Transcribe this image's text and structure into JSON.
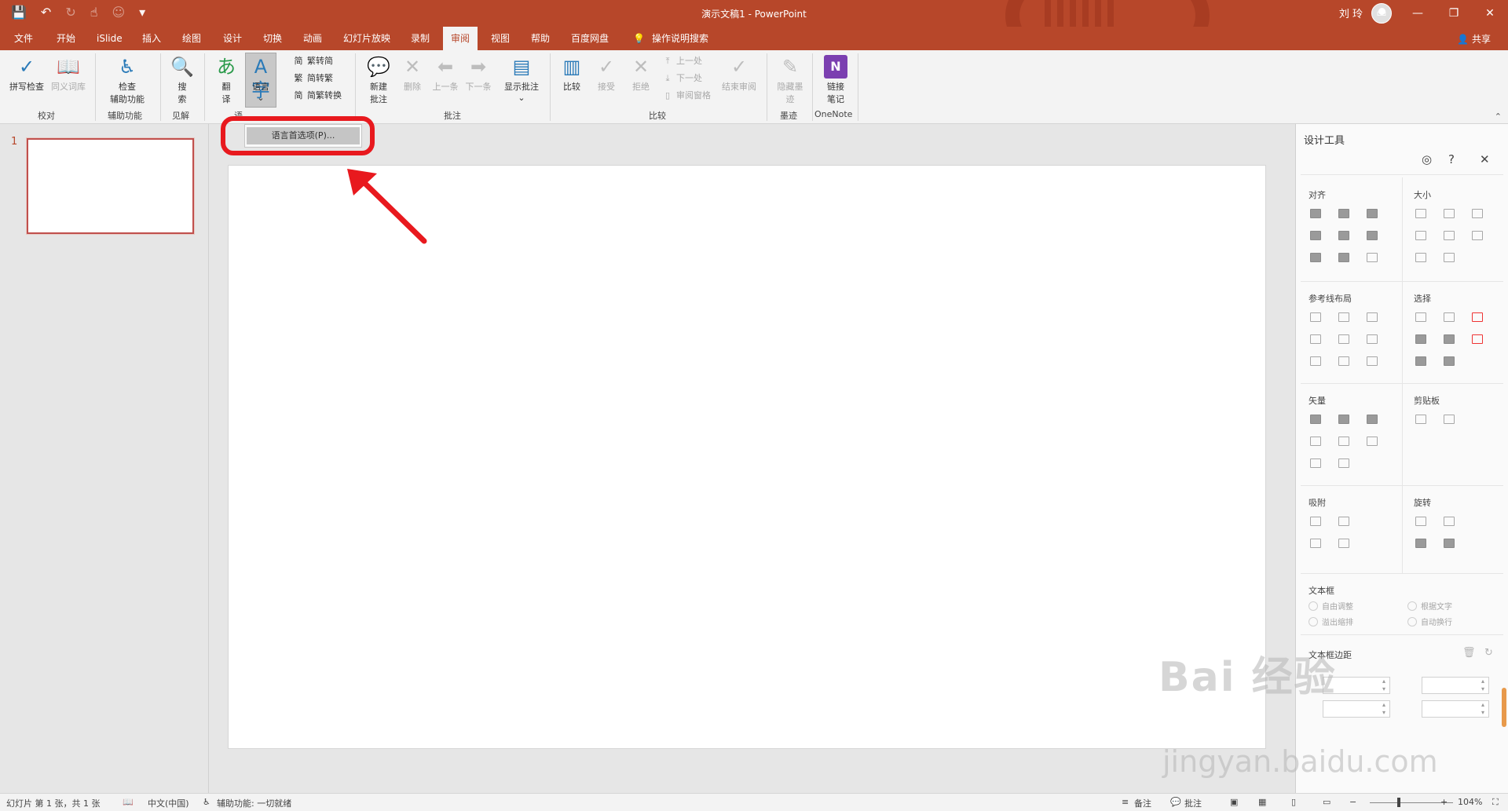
{
  "window": {
    "title": "演示文稿1  -  PowerPoint",
    "user": "刘 玲"
  },
  "tabs": [
    {
      "label": "文件"
    },
    {
      "label": "开始"
    },
    {
      "label": "iSlide"
    },
    {
      "label": "插入"
    },
    {
      "label": "绘图"
    },
    {
      "label": "设计"
    },
    {
      "label": "切换"
    },
    {
      "label": "动画"
    },
    {
      "label": "幻灯片放映"
    },
    {
      "label": "录制"
    },
    {
      "label": "审阅"
    },
    {
      "label": "视图"
    },
    {
      "label": "帮助"
    },
    {
      "label": "百度网盘"
    },
    {
      "label": "操作说明搜索"
    }
  ],
  "share_label": "共享",
  "ribbon": {
    "spell": "拼写检查",
    "thesaurus": "同义词库",
    "group_proof": "校对",
    "check_access": "检查",
    "check_access2": "辅助功能",
    "group_access": "辅助功能",
    "search": "搜",
    "search2": "索",
    "group_insight": "见解",
    "translate": "翻",
    "translate2": "译",
    "language": "语言",
    "group_lang": "语",
    "t2s": "繁转简",
    "s2t": "简转繁",
    "conv": "简繁转换",
    "new_comment": "新建",
    "new_comment2": "批注",
    "delete": "删除",
    "prev": "上一条",
    "next": "下一条",
    "show_comments": "显示批注",
    "group_comments": "批注",
    "compare": "比较",
    "accept": "接受",
    "reject": "拒绝",
    "prev_change": "上一处",
    "next_change": "下一处",
    "review_pane": "审阅窗格",
    "end_review": "结束审阅",
    "group_compare": "比较",
    "hide_ink": "隐藏墨",
    "hide_ink2": "迹",
    "group_ink": "墨迹",
    "link_notes": "链接",
    "link_notes2": "笔记",
    "group_onenote": "OneNote"
  },
  "menu": {
    "language_prefs": "语言首选项(P)..."
  },
  "thumbnails": {
    "slide_number": "1"
  },
  "design_pane": {
    "title": "设计工具",
    "sections": {
      "align": "对齐",
      "size": "大小",
      "guides": "参考线布局",
      "select": "选择",
      "vector": "矢量",
      "clipboard": "剪贴板",
      "snap": "吸附",
      "rotate": "旋转",
      "textbox": "文本框",
      "margins": "文本框边距"
    },
    "textbox_options": [
      "自由调整",
      "根据文字",
      "溢出缩排",
      "自动换行"
    ]
  },
  "watermark": {
    "main": "Bai 经验",
    "sub": "jingyan.baidu.com"
  },
  "status": {
    "slide_info": "幻灯片 第 1 张，共 1 张",
    "language": "中文(中国)",
    "accessibility": "辅助功能: 一切就绪",
    "notes": "备注",
    "comments": "批注",
    "zoom": "104%"
  },
  "colors": {
    "accent": "#b7472a",
    "highlight": "#e8191e"
  }
}
